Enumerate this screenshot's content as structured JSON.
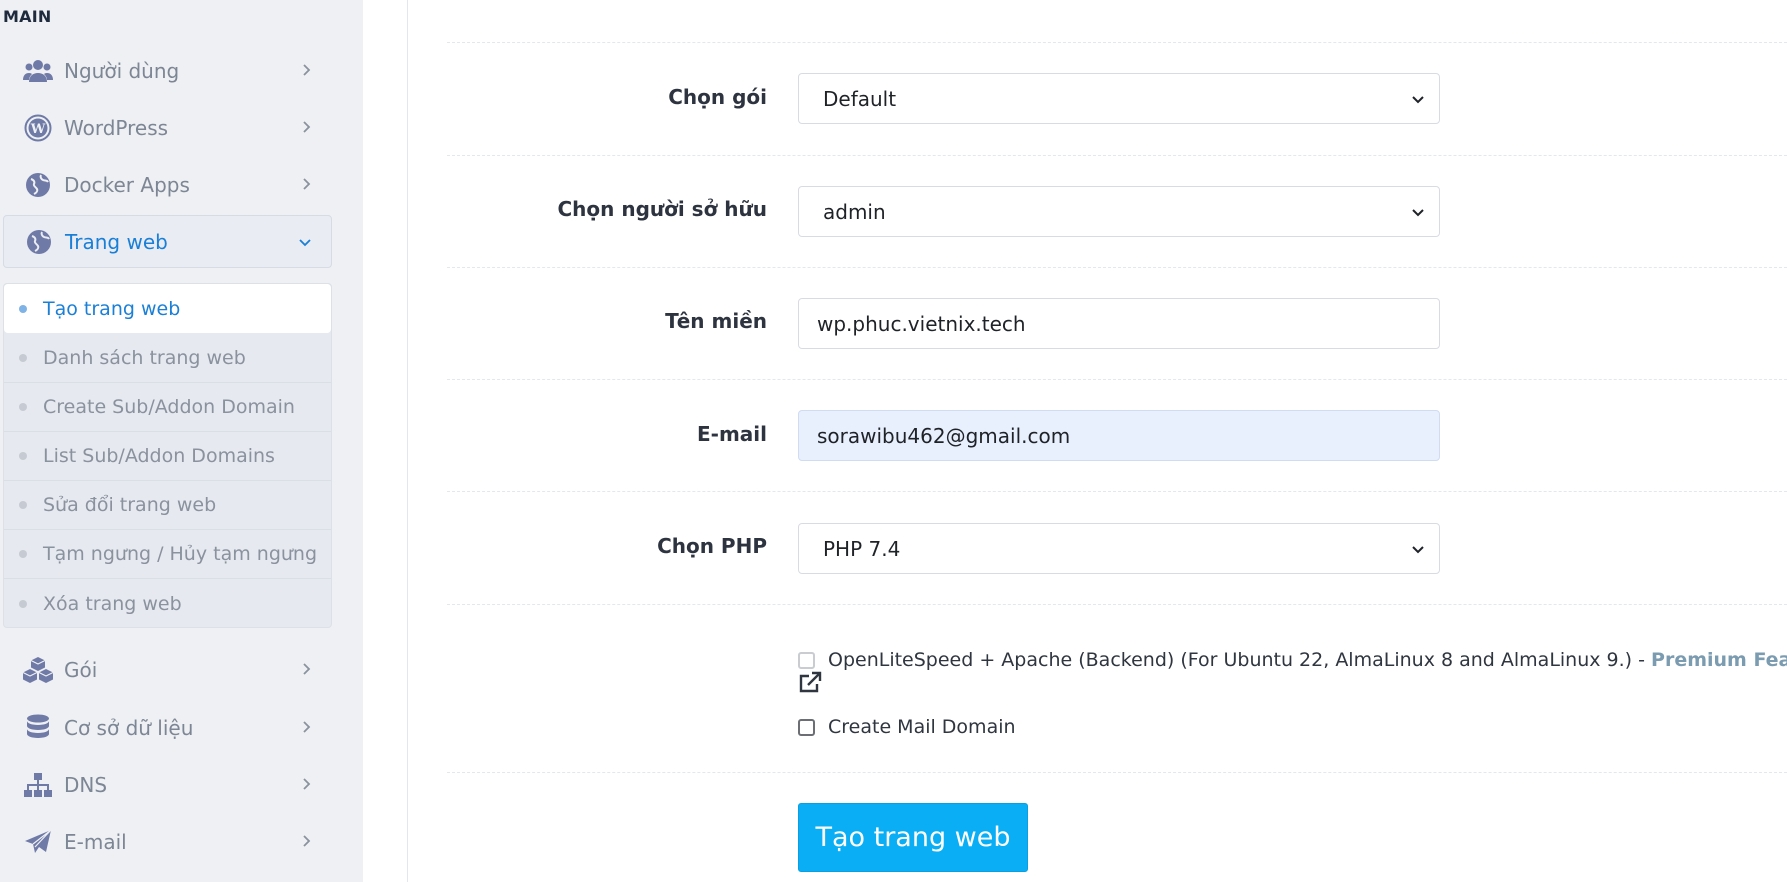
{
  "sidebar": {
    "heading": "MAIN",
    "items": [
      {
        "label": "Người dùng",
        "icon": "users-icon"
      },
      {
        "label": "WordPress",
        "icon": "wordpress-icon"
      },
      {
        "label": "Docker Apps",
        "icon": "globe-icon"
      },
      {
        "label": "Trang web",
        "icon": "globe-icon",
        "expanded": true
      },
      {
        "label": "Gói",
        "icon": "cubes-icon"
      },
      {
        "label": "Cơ sở dữ liệu",
        "icon": "database-icon"
      },
      {
        "label": "DNS",
        "icon": "sitemap-icon"
      },
      {
        "label": "E-mail",
        "icon": "paper-plane-icon"
      }
    ],
    "submenu": [
      {
        "label": "Tạo trang web",
        "current": true
      },
      {
        "label": "Danh sách trang web"
      },
      {
        "label": "Create Sub/Addon Domain"
      },
      {
        "label": "List Sub/Addon Domains"
      },
      {
        "label": "Sửa đổi trang web"
      },
      {
        "label": "Tạm ngưng / Hủy tạm ngưng"
      },
      {
        "label": "Xóa trang web"
      }
    ]
  },
  "form": {
    "package": {
      "label": "Chọn gói",
      "value": "Default"
    },
    "owner": {
      "label": "Chọn người sở hữu",
      "value": "admin"
    },
    "domain": {
      "label": "Tên miền",
      "value": "wp.phuc.vietnix.tech"
    },
    "email": {
      "label": "E-mail",
      "value": "sorawibu462@gmail.com"
    },
    "php": {
      "label": "Chọn PHP",
      "value": "PHP 7.4"
    },
    "ols_option": {
      "text": "OpenLiteSpeed + Apache (Backend) (For Ubuntu 22, AlmaLinux 8 and AlmaLinux 9.) - ",
      "premium": "Premium Feature",
      "checked": false,
      "disabled": true
    },
    "mail_domain": {
      "text": "Create Mail Domain",
      "checked": false
    },
    "submit_label": "Tạo trang web"
  },
  "colors": {
    "accent": "#1a7fd6",
    "button": "#0aaef5",
    "sidebar_bg": "#eef0f4",
    "icon": "#6f7aa6"
  }
}
